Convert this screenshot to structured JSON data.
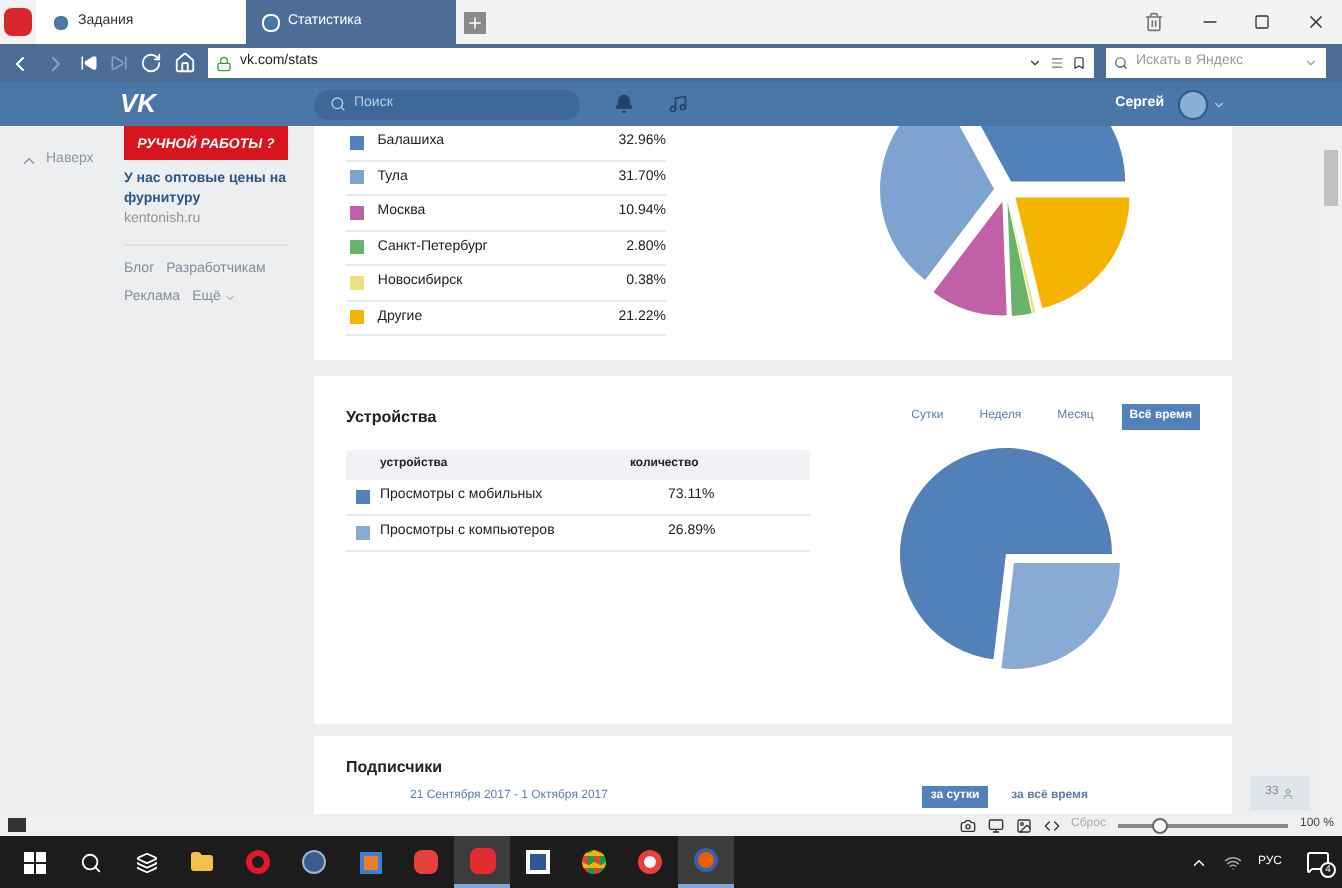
{
  "browser": {
    "tabs": [
      {
        "title": "Задания",
        "selected": false
      },
      {
        "title": "Статистика",
        "selected": true
      }
    ],
    "url": "vk.com/stats",
    "search_placeholder": "Искать в Яндекс"
  },
  "header": {
    "logo": "VK",
    "search_placeholder": "Поиск",
    "user": "Сергей"
  },
  "sidebar": {
    "back_to_top": "Наверх",
    "ad_banner": "РУЧНОЙ РАБОТЫ ?",
    "ad_text": "У нас оптовые цены на фурнитуру",
    "ad_domain": "kentonish.ru",
    "links": [
      "Блог",
      "Разработчикам",
      "Реклама",
      "Ещё"
    ]
  },
  "cities": {
    "rows": [
      {
        "name": "Балашиха",
        "value": "32.96%",
        "color": "#5181b8"
      },
      {
        "name": "Тула",
        "value": "31.70%",
        "color": "#7fa3d1"
      },
      {
        "name": "Москва",
        "value": "10.94%",
        "color": "#c160a6"
      },
      {
        "name": "Санкт-Петербург",
        "value": "2.80%",
        "color": "#6bb26b"
      },
      {
        "name": "Новосибирск",
        "value": "0.38%",
        "color": "#ece37c"
      },
      {
        "name": "Другие",
        "value": "21.22%",
        "color": "#f4b400"
      }
    ],
    "chart_data": {
      "type": "pie",
      "values": [
        32.96,
        31.7,
        10.94,
        2.8,
        0.38,
        21.22
      ]
    }
  },
  "devices": {
    "title": "Устройства",
    "periods": [
      {
        "label": "Сутки",
        "selected": false
      },
      {
        "label": "Неделя",
        "selected": false
      },
      {
        "label": "Месяц",
        "selected": false
      },
      {
        "label": "Всё время",
        "selected": true
      }
    ],
    "columns": [
      "устройства",
      "количество"
    ],
    "rows": [
      {
        "name": "Просмотры с мобильных",
        "value": "73.11%",
        "color": "#5181b8"
      },
      {
        "name": "Просмотры с компьютеров",
        "value": "26.89%",
        "color": "#8aaad6"
      }
    ],
    "chart_data": {
      "type": "pie",
      "values": [
        73.11,
        26.89
      ]
    }
  },
  "subscribers": {
    "title": "Подписчики",
    "date_range": "21 Сентября 2017 - 1 Октября 2017",
    "periods": [
      {
        "label": "за сутки",
        "selected": true
      },
      {
        "label": "за всё время",
        "selected": false
      }
    ]
  },
  "friends_counter": "33",
  "status_bar": {
    "reset": "Сброс",
    "zoom": {
      "level": 0.25
    },
    "zoom_text": "100 %"
  },
  "taskbar": {
    "language": "РУС",
    "notifications": "4"
  }
}
